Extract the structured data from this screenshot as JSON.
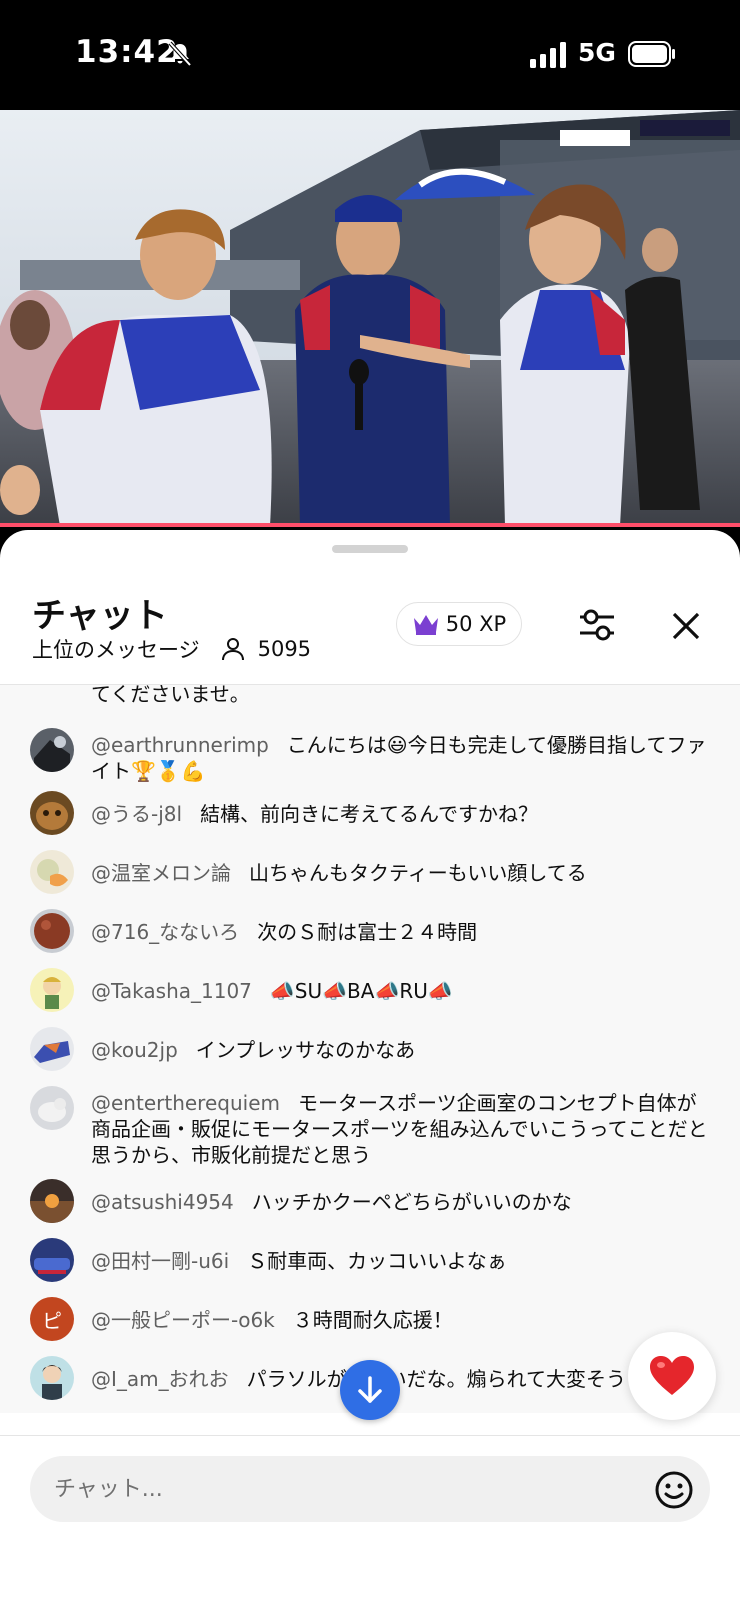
{
  "status_bar": {
    "time": "13:42",
    "network": "5G",
    "icons": [
      "bell-off-icon",
      "signal-icon",
      "battery-icon"
    ]
  },
  "video": {
    "description_icons": [
      "video-player"
    ],
    "progress_color": "#ff4e6a"
  },
  "chat": {
    "title": "チャット",
    "mode": "上位のメッセージ",
    "viewer_count": "5095",
    "xp": "50 XP",
    "accent_crown_color": "#7b3fd1"
  },
  "messages": [
    {
      "author": "",
      "text": "てくださいませ。"
    },
    {
      "author": "@earthrunnerimp",
      "text": "こんにちは😃今日も完走して優勝目指してファイト🏆🥇💪"
    },
    {
      "author": "@うる-j8l",
      "text": "結構、前向きに考えてるんですかね？"
    },
    {
      "author": "@温室メロン論",
      "text": "山ちゃんもタクティーもいい顔してる"
    },
    {
      "author": "@716_なないろ",
      "text": "次のＳ耐は富士２４時間"
    },
    {
      "author": "@Takasha_1107",
      "text": "📣SU📣BA📣RU📣"
    },
    {
      "author": "@kou2jp",
      "text": "インプレッサなのかなあ"
    },
    {
      "author": "@entertherequiem",
      "text": "モータースポーツ企画室のコンセプト自体が商品企画・販促にモータースポーツを組み込んでいこうってことだと思うから、市販化前提だと思う"
    },
    {
      "author": "@atsushi4954",
      "text": "ハッチかクーペどちらがいいのかな"
    },
    {
      "author": "@田村一剛-u6i",
      "text": "Ｓ耐車両、カッコいいよなぁ"
    },
    {
      "author": "@一般ピーポー-o6k",
      "text": "３時間耐久応援！"
    },
    {
      "author": "@I_am_おれお",
      "text": "パラソルがデカいだな。煽られて大変そう"
    }
  ],
  "avatar_letters": {
    "pipo": "ピ"
  },
  "input": {
    "placeholder": "チャット..."
  },
  "buttons": {
    "heart": "❤️"
  }
}
